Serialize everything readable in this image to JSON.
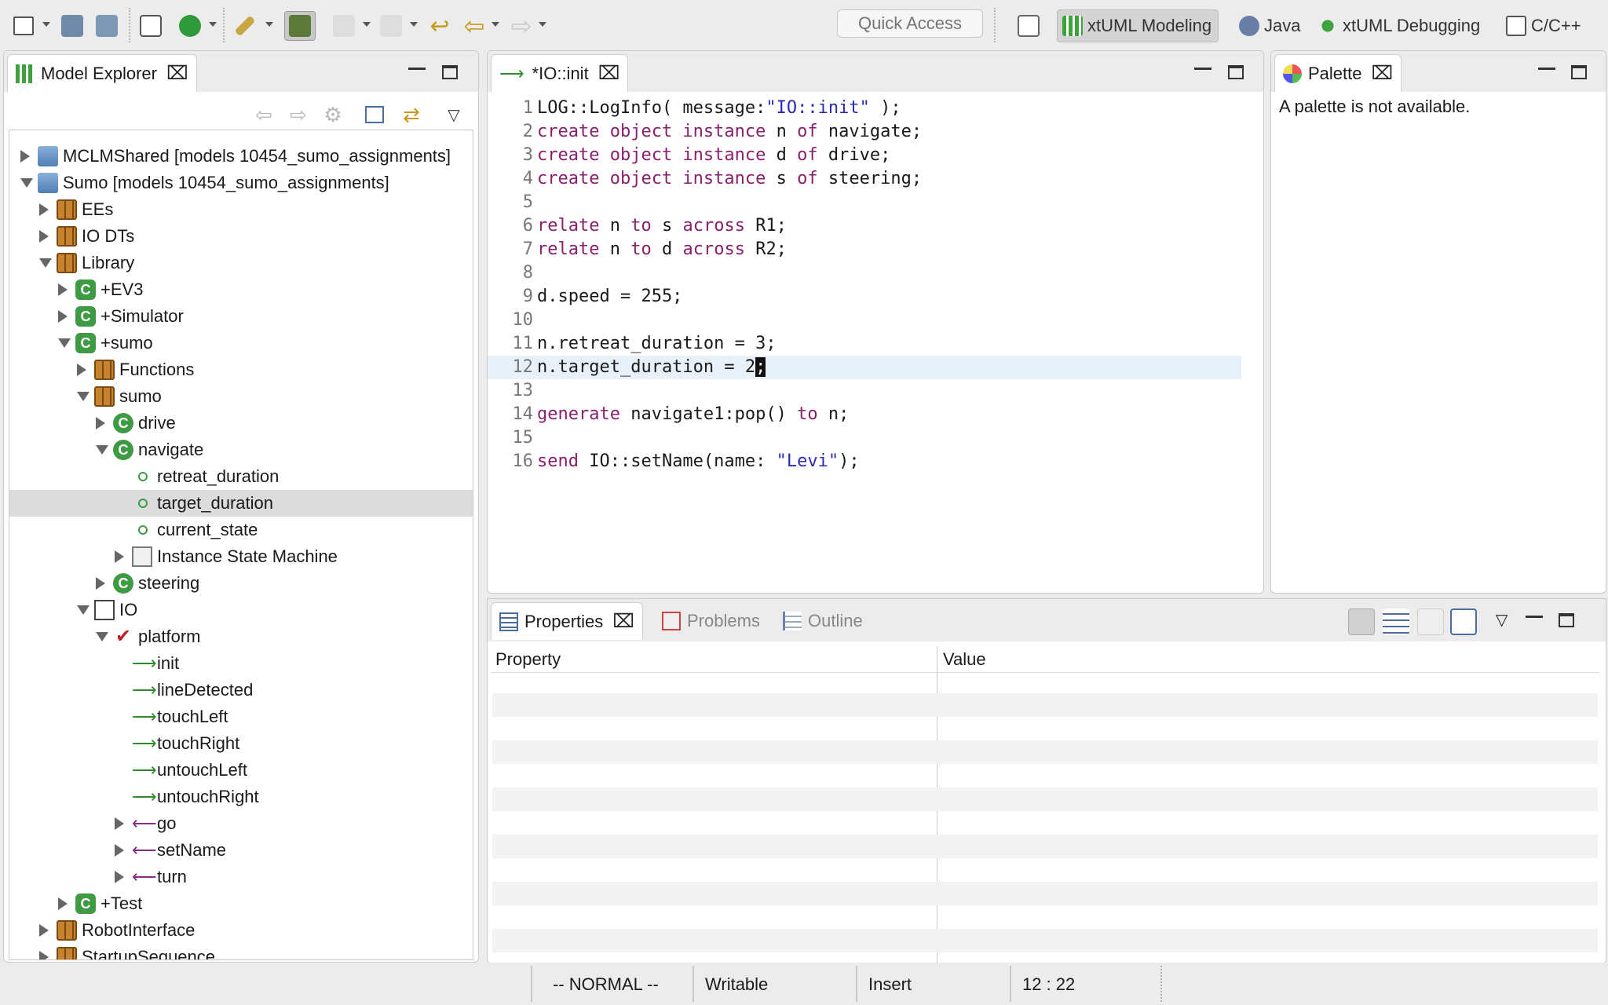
{
  "toolbar": {
    "quick_access_placeholder": "Quick Access",
    "perspectives": [
      {
        "label": "xtUML Modeling",
        "icon": "xtuml-modeling-icon",
        "active": true
      },
      {
        "label": "Java",
        "icon": "java-icon",
        "active": false
      },
      {
        "label": "xtUML Debugging",
        "icon": "xtuml-debug-icon",
        "active": false
      },
      {
        "label": "C/C++",
        "icon": "cpp-icon",
        "active": false
      }
    ]
  },
  "explorer": {
    "title": "Model Explorer",
    "tree": [
      {
        "label": "MCLMShared [models 10454_sumo_assignments]",
        "icon": "project-icon",
        "twisty": "closed",
        "level": 0
      },
      {
        "label": "Sumo [models 10454_sumo_assignments]",
        "icon": "project-icon",
        "twisty": "open",
        "level": 0
      },
      {
        "label": "EEs",
        "icon": "package-icon",
        "twisty": "closed",
        "level": 1
      },
      {
        "label": "IO DTs",
        "icon": "package-icon",
        "twisty": "closed",
        "level": 1
      },
      {
        "label": "Library",
        "icon": "package-icon",
        "twisty": "open",
        "level": 1
      },
      {
        "label": "+EV3",
        "icon": "component-icon",
        "twisty": "closed",
        "level": 2
      },
      {
        "label": "+Simulator",
        "icon": "component-icon",
        "twisty": "closed",
        "level": 2
      },
      {
        "label": "+sumo",
        "icon": "component-icon",
        "twisty": "open",
        "level": 2
      },
      {
        "label": "Functions",
        "icon": "package-icon",
        "twisty": "closed",
        "level": 3
      },
      {
        "label": "sumo",
        "icon": "package-icon",
        "twisty": "open",
        "level": 3
      },
      {
        "label": "drive",
        "icon": "class-icon",
        "twisty": "closed",
        "level": 4
      },
      {
        "label": "navigate",
        "icon": "class-icon",
        "twisty": "open",
        "level": 4
      },
      {
        "label": "retreat_duration",
        "icon": "attribute-icon",
        "twisty": "none",
        "level": 5
      },
      {
        "label": "target_duration",
        "icon": "attribute-icon",
        "twisty": "none",
        "level": 5,
        "selected": true
      },
      {
        "label": "current_state",
        "icon": "attribute-icon",
        "twisty": "none",
        "level": 5
      },
      {
        "label": "Instance State Machine",
        "icon": "state-machine-icon",
        "twisty": "closed",
        "level": 5
      },
      {
        "label": "steering",
        "icon": "class-icon",
        "twisty": "closed",
        "level": 4
      },
      {
        "label": "IO",
        "icon": "interface-icon",
        "twisty": "open",
        "level": 3
      },
      {
        "label": "platform",
        "icon": "port-icon",
        "twisty": "open",
        "level": 4
      },
      {
        "label": "init",
        "icon": "incoming-message-icon",
        "twisty": "none",
        "level": 5
      },
      {
        "label": "lineDetected",
        "icon": "incoming-message-icon",
        "twisty": "none",
        "level": 5
      },
      {
        "label": "touchLeft",
        "icon": "incoming-message-icon",
        "twisty": "none",
        "level": 5
      },
      {
        "label": "touchRight",
        "icon": "incoming-message-icon",
        "twisty": "none",
        "level": 5
      },
      {
        "label": "untouchLeft",
        "icon": "incoming-message-icon",
        "twisty": "none",
        "level": 5
      },
      {
        "label": "untouchRight",
        "icon": "incoming-message-icon",
        "twisty": "none",
        "level": 5
      },
      {
        "label": "go",
        "icon": "outgoing-message-icon",
        "twisty": "closed",
        "level": 5
      },
      {
        "label": "setName",
        "icon": "outgoing-message-icon",
        "twisty": "closed",
        "level": 5
      },
      {
        "label": "turn",
        "icon": "outgoing-message-icon",
        "twisty": "closed",
        "level": 5
      },
      {
        "label": "+Test",
        "icon": "component-icon",
        "twisty": "closed",
        "level": 2
      },
      {
        "label": "RobotInterface",
        "icon": "package-icon",
        "twisty": "closed",
        "level": 1
      },
      {
        "label": "StartupSequence",
        "icon": "package-icon",
        "twisty": "closed",
        "level": 1
      }
    ]
  },
  "editor": {
    "tab_title": "*IO::init",
    "lines": [
      {
        "num": "1",
        "tokens": [
          [
            "LOG::LogInfo( message:",
            ""
          ],
          [
            "\"IO::init\"",
            "str"
          ],
          [
            " );",
            ""
          ]
        ]
      },
      {
        "num": "2",
        "tokens": [
          [
            "create object instance",
            "kw"
          ],
          [
            " n ",
            ""
          ],
          [
            "of",
            "kw"
          ],
          [
            " navigate;",
            ""
          ]
        ]
      },
      {
        "num": "3",
        "tokens": [
          [
            "create object instance",
            "kw"
          ],
          [
            " d ",
            ""
          ],
          [
            "of",
            "kw"
          ],
          [
            " drive;",
            ""
          ]
        ]
      },
      {
        "num": "4",
        "tokens": [
          [
            "create object instance",
            "kw"
          ],
          [
            " s ",
            ""
          ],
          [
            "of",
            "kw"
          ],
          [
            " steering;",
            ""
          ]
        ]
      },
      {
        "num": "5",
        "tokens": []
      },
      {
        "num": "6",
        "tokens": [
          [
            "relate",
            "kw"
          ],
          [
            " n ",
            ""
          ],
          [
            "to",
            "kw"
          ],
          [
            " s ",
            ""
          ],
          [
            "across",
            "kw"
          ],
          [
            " R1;",
            ""
          ]
        ]
      },
      {
        "num": "7",
        "tokens": [
          [
            "relate",
            "kw"
          ],
          [
            " n ",
            ""
          ],
          [
            "to",
            "kw"
          ],
          [
            " d ",
            ""
          ],
          [
            "across",
            "kw"
          ],
          [
            " R2;",
            ""
          ]
        ]
      },
      {
        "num": "8",
        "tokens": []
      },
      {
        "num": "9",
        "tokens": [
          [
            "d.speed = 255;",
            ""
          ]
        ]
      },
      {
        "num": "10",
        "tokens": []
      },
      {
        "num": "11",
        "tokens": [
          [
            "n.retreat_duration = 3;",
            ""
          ]
        ]
      },
      {
        "num": "12",
        "tokens": [
          [
            "n.target_duration = 2",
            ""
          ],
          [
            ";",
            "caret"
          ]
        ],
        "current": true
      },
      {
        "num": "13",
        "tokens": []
      },
      {
        "num": "14",
        "tokens": [
          [
            "generate",
            "kw"
          ],
          [
            " navigate1:pop() ",
            ""
          ],
          [
            "to",
            "kw"
          ],
          [
            " n;",
            ""
          ]
        ]
      },
      {
        "num": "15",
        "tokens": []
      },
      {
        "num": "16",
        "tokens": [
          [
            "send",
            "kw"
          ],
          [
            " IO::setName(name: ",
            ""
          ],
          [
            "\"Levi\"",
            "str"
          ],
          [
            ");",
            ""
          ]
        ]
      }
    ]
  },
  "palette": {
    "title": "Palette",
    "message": "A palette is not available."
  },
  "properties": {
    "tabs": [
      {
        "label": "Properties",
        "icon": "properties-icon",
        "active": true
      },
      {
        "label": "Problems",
        "icon": "problems-icon",
        "active": false
      },
      {
        "label": "Outline",
        "icon": "outline-icon",
        "active": false
      }
    ],
    "col_property": "Property",
    "col_value": "Value"
  },
  "status": {
    "mode": "-- NORMAL --",
    "writable": "Writable",
    "insert": "Insert",
    "position": "12 : 22"
  }
}
